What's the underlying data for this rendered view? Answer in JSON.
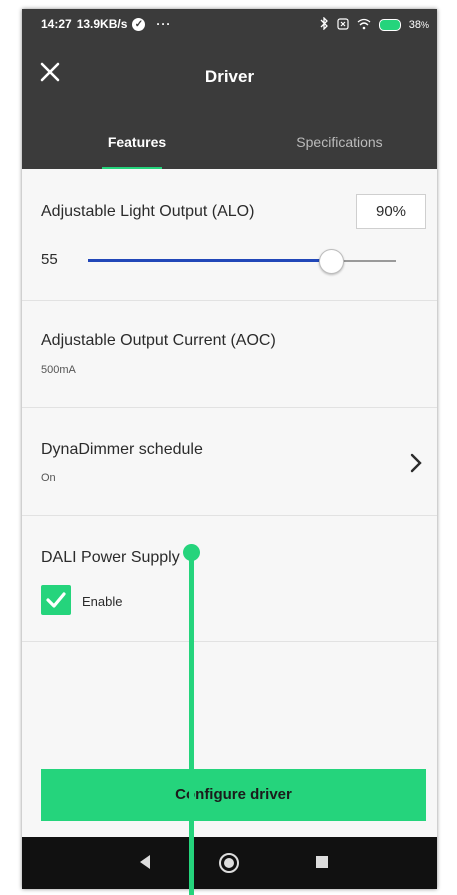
{
  "status_bar": {
    "time": "14:27",
    "speed": "13.9KB/s",
    "more": "···",
    "bluetooth_icon": "bluetooth-icon",
    "sim_icon": "sim-icon",
    "wifi_icon": "wifi-icon",
    "battery_level": "38",
    "battery_unit": "%"
  },
  "header": {
    "title": "Driver",
    "close_icon": "close-icon",
    "tabs": [
      {
        "label": "Features",
        "active": true
      },
      {
        "label": "Specifications",
        "active": false
      }
    ]
  },
  "features": {
    "alo": {
      "title": "Adjustable Light Output (ALO)",
      "input_value": "90%",
      "slider_value": "55",
      "slider_fraction": 0.79
    },
    "aoc": {
      "title": "Adjustable Output Current (AOC)",
      "value": "500mA"
    },
    "dynadimmer": {
      "title": "DynaDimmer schedule",
      "value": "On"
    },
    "dali": {
      "title": "DALI Power Supply",
      "checkbox_label": "Enable",
      "checked": true
    }
  },
  "actions": {
    "configure_label": "Configure driver"
  },
  "colors": {
    "accent": "#25d47c",
    "header_bg": "#3b3b3b",
    "slider_fill": "#2147b8",
    "nav_bg": "#111111"
  }
}
